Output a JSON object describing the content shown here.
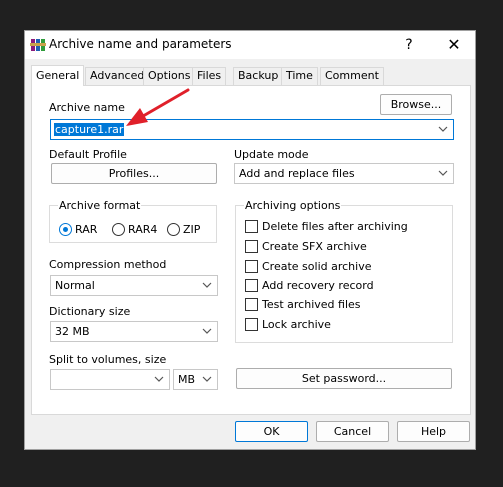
{
  "window": {
    "title": "Archive name and parameters",
    "help_label": "?",
    "close_label": "✕"
  },
  "tabs": [
    {
      "label": "General",
      "active": true
    },
    {
      "label": "Advanced"
    },
    {
      "label": "Options"
    },
    {
      "label": "Files"
    },
    {
      "label": "Backup"
    },
    {
      "label": "Time"
    },
    {
      "label": "Comment"
    }
  ],
  "archive_name": {
    "label": "Archive name",
    "value": "capture1.rar",
    "browse_label": "Browse..."
  },
  "default_profile": {
    "label": "Default Profile",
    "button_label": "Profiles..."
  },
  "update_mode": {
    "label": "Update mode",
    "value": "Add and replace files"
  },
  "archive_format": {
    "label": "Archive format",
    "options": [
      "RAR",
      "RAR4",
      "ZIP"
    ],
    "selected": "RAR"
  },
  "compression_method": {
    "label": "Compression method",
    "value": "Normal"
  },
  "dictionary_size": {
    "label": "Dictionary size",
    "value": "32 MB"
  },
  "split_volumes": {
    "label": "Split to volumes, size",
    "value": "",
    "unit": "MB"
  },
  "archiving_options": {
    "label": "Archiving options",
    "items": [
      {
        "label": "Delete files after archiving",
        "checked": false
      },
      {
        "label": "Create SFX archive",
        "checked": false
      },
      {
        "label": "Create solid archive",
        "checked": false
      },
      {
        "label": "Add recovery record",
        "checked": false
      },
      {
        "label": "Test archived files",
        "checked": false
      },
      {
        "label": "Lock archive",
        "checked": false
      }
    ]
  },
  "set_password_label": "Set password...",
  "footer": {
    "ok_label": "OK",
    "cancel_label": "Cancel",
    "help_label": "Help"
  },
  "colors": {
    "accent": "#0078d7",
    "annotation_arrow": "#e0202a"
  }
}
